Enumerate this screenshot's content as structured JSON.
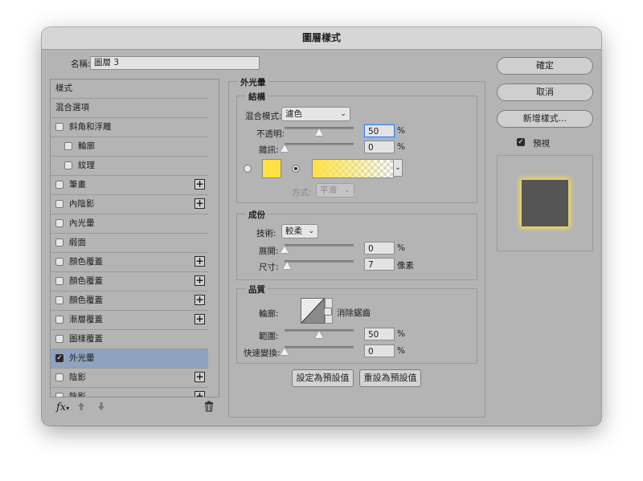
{
  "dialog": {
    "title": "圖層樣式"
  },
  "name_field": {
    "label": "名稱:",
    "value": "圖層 3"
  },
  "styles_list": {
    "items": [
      {
        "label": "樣式",
        "checkbox": false,
        "checked": false,
        "indent": 0,
        "plus": false,
        "selected": false
      },
      {
        "label": "混合選項",
        "checkbox": false,
        "checked": false,
        "indent": 0,
        "plus": false,
        "selected": false
      },
      {
        "label": "斜角和浮雕",
        "checkbox": true,
        "checked": false,
        "indent": 0,
        "plus": false,
        "selected": false
      },
      {
        "label": "輪廓",
        "checkbox": true,
        "checked": false,
        "indent": 1,
        "plus": false,
        "selected": false
      },
      {
        "label": "紋理",
        "checkbox": true,
        "checked": false,
        "indent": 1,
        "plus": false,
        "selected": false
      },
      {
        "label": "筆畫",
        "checkbox": true,
        "checked": false,
        "indent": 0,
        "plus": true,
        "selected": false
      },
      {
        "label": "內陰影",
        "checkbox": true,
        "checked": false,
        "indent": 0,
        "plus": true,
        "selected": false
      },
      {
        "label": "內光暈",
        "checkbox": true,
        "checked": false,
        "indent": 0,
        "plus": false,
        "selected": false
      },
      {
        "label": "緞面",
        "checkbox": true,
        "checked": false,
        "indent": 0,
        "plus": false,
        "selected": false
      },
      {
        "label": "顏色覆蓋",
        "checkbox": true,
        "checked": false,
        "indent": 0,
        "plus": true,
        "selected": false
      },
      {
        "label": "顏色覆蓋",
        "checkbox": true,
        "checked": false,
        "indent": 0,
        "plus": true,
        "selected": false
      },
      {
        "label": "顏色覆蓋",
        "checkbox": true,
        "checked": false,
        "indent": 0,
        "plus": true,
        "selected": false
      },
      {
        "label": "漸層覆蓋",
        "checkbox": true,
        "checked": false,
        "indent": 0,
        "plus": true,
        "selected": false
      },
      {
        "label": "圖樣覆蓋",
        "checkbox": true,
        "checked": false,
        "indent": 0,
        "plus": false,
        "selected": false
      },
      {
        "label": "外光暈",
        "checkbox": true,
        "checked": true,
        "indent": 0,
        "plus": false,
        "selected": true
      },
      {
        "label": "陰影",
        "checkbox": true,
        "checked": false,
        "indent": 0,
        "plus": true,
        "selected": false
      },
      {
        "label": "陰影",
        "checkbox": true,
        "checked": false,
        "indent": 0,
        "plus": true,
        "selected": false
      }
    ]
  },
  "footer": {
    "fx": "fx",
    "icons": [
      "fx-icon",
      "move-up-icon",
      "move-down-icon",
      "trash-icon"
    ]
  },
  "panel": {
    "title": "外光暈",
    "structure": {
      "title": "結構",
      "blend_mode_label": "混合模式:",
      "blend_mode_value": "濾色",
      "opacity_label": "不透明:",
      "opacity_value": "50",
      "opacity_unit": "%",
      "opacity_level": 0.5,
      "noise_label": "雜訊:",
      "noise_value": "0",
      "noise_unit": "%",
      "noise_level": 0,
      "glow_color": "#ffe144",
      "method_label": "方式:",
      "method_value": "平滑"
    },
    "elements": {
      "title": "成份",
      "technique_label": "技術:",
      "technique_value": "較柔",
      "spread_label": "展開:",
      "spread_value": "0",
      "spread_unit": "%",
      "spread_level": 0,
      "size_label": "尺寸:",
      "size_value": "7",
      "size_unit": "像素",
      "size_level": 0.03
    },
    "quality": {
      "title": "品質",
      "contour_label": "輪廓:",
      "antialias_label": "消除鋸齒",
      "antialias_checked": false,
      "range_label": "範圍:",
      "range_value": "50",
      "range_unit": "%",
      "range_level": 0.5,
      "jitter_label": "快速變換:",
      "jitter_value": "0",
      "jitter_unit": "%",
      "jitter_level": 0
    },
    "set_default_label": "設定為預設值",
    "reset_default_label": "重設為預設值"
  },
  "buttons": {
    "ok": "確定",
    "cancel": "取消",
    "new_style": "新增樣式...",
    "preview_label": "預視",
    "preview_checked": true
  },
  "colors": {
    "dialog_bg": "#b4b4b4",
    "selection": "#8ea3bf",
    "glow": "#ffe144",
    "preview_swatch": "#555555"
  }
}
